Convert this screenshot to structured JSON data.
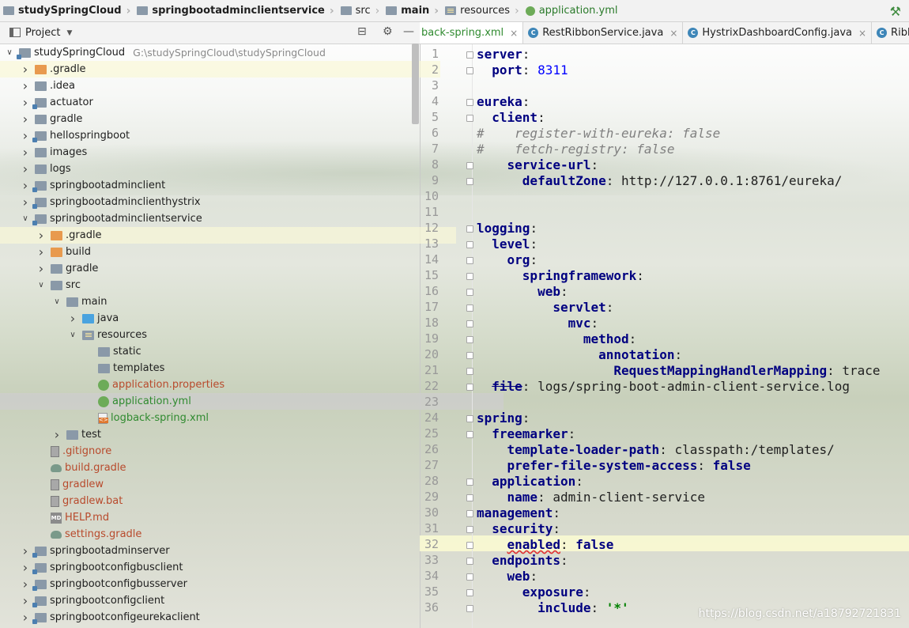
{
  "breadcrumbs": [
    {
      "label": "studySpringCloud",
      "icon": "folder-icon",
      "bold": true
    },
    {
      "label": "springbootadminclientservice",
      "icon": "module-folder-icon",
      "bold": true
    },
    {
      "label": "src",
      "icon": "folder-icon"
    },
    {
      "label": "main",
      "icon": "folder-icon",
      "bold": true
    },
    {
      "label": "resources",
      "icon": "resources-folder-icon"
    },
    {
      "label": "application.yml",
      "icon": "spring-leaf-icon",
      "file": true
    }
  ],
  "project_pane": {
    "title": "Project"
  },
  "tree": [
    {
      "label": "studySpringCloud",
      "path": "G:\\studySpringCloud\\studySpringCloud",
      "depth": 0,
      "arrow": "down",
      "icon": "fo mod"
    },
    {
      "label": ".gradle",
      "depth": 1,
      "arrow": "right",
      "icon": "fo org",
      "hl": true
    },
    {
      "label": ".idea",
      "depth": 1,
      "arrow": "right",
      "icon": "fo"
    },
    {
      "label": "actuator",
      "depth": 1,
      "arrow": "right",
      "icon": "fo mod"
    },
    {
      "label": "gradle",
      "depth": 1,
      "arrow": "right",
      "icon": "fo"
    },
    {
      "label": "hellospringboot",
      "depth": 1,
      "arrow": "right",
      "icon": "fo mod"
    },
    {
      "label": "images",
      "depth": 1,
      "arrow": "right",
      "icon": "fo"
    },
    {
      "label": "logs",
      "depth": 1,
      "arrow": "right",
      "icon": "fo"
    },
    {
      "label": "springbootadminclient",
      "depth": 1,
      "arrow": "right",
      "icon": "fo mod"
    },
    {
      "label": "springbootadminclienthystrix",
      "depth": 1,
      "arrow": "right",
      "icon": "fo mod"
    },
    {
      "label": "springbootadminclientservice",
      "depth": 1,
      "arrow": "down",
      "icon": "fo mod"
    },
    {
      "label": ".gradle",
      "depth": 2,
      "arrow": "right",
      "icon": "fo org",
      "hl": true
    },
    {
      "label": "build",
      "depth": 2,
      "arrow": "right",
      "icon": "fo org"
    },
    {
      "label": "gradle",
      "depth": 2,
      "arrow": "right",
      "icon": "fo"
    },
    {
      "label": "src",
      "depth": 2,
      "arrow": "down",
      "icon": "fo"
    },
    {
      "label": "main",
      "depth": 3,
      "arrow": "down",
      "icon": "fo"
    },
    {
      "label": "java",
      "depth": 4,
      "arrow": "right",
      "icon": "fo blue"
    },
    {
      "label": "resources",
      "depth": 4,
      "arrow": "down",
      "icon": "fo res"
    },
    {
      "label": "static",
      "depth": 5,
      "arrow": "",
      "icon": "fo"
    },
    {
      "label": "templates",
      "depth": 5,
      "arrow": "",
      "icon": "fo"
    },
    {
      "label": "application.properties",
      "depth": 5,
      "arrow": "",
      "icon": "leaf",
      "color": "red"
    },
    {
      "label": "application.yml",
      "depth": 5,
      "arrow": "",
      "icon": "leaf",
      "color": "green",
      "sel": true
    },
    {
      "label": "logback-spring.xml",
      "depth": 5,
      "arrow": "",
      "icon": "xml",
      "color": "green"
    },
    {
      "label": "test",
      "depth": 3,
      "arrow": "right",
      "icon": "fo"
    },
    {
      "label": ".gitignore",
      "depth": 2,
      "arrow": "",
      "icon": "file",
      "color": "red"
    },
    {
      "label": "build.gradle",
      "depth": 2,
      "arrow": "",
      "icon": "gradle",
      "color": "red"
    },
    {
      "label": "gradlew",
      "depth": 2,
      "arrow": "",
      "icon": "file",
      "color": "red"
    },
    {
      "label": "gradlew.bat",
      "depth": 2,
      "arrow": "",
      "icon": "file",
      "color": "red"
    },
    {
      "label": "HELP.md",
      "depth": 2,
      "arrow": "",
      "icon": "md",
      "color": "red"
    },
    {
      "label": "settings.gradle",
      "depth": 2,
      "arrow": "",
      "icon": "gradle",
      "color": "red"
    },
    {
      "label": "springbootadminserver",
      "depth": 1,
      "arrow": "right",
      "icon": "fo mod"
    },
    {
      "label": "springbootconfigbusclient",
      "depth": 1,
      "arrow": "right",
      "icon": "fo mod"
    },
    {
      "label": "springbootconfigbusserver",
      "depth": 1,
      "arrow": "right",
      "icon": "fo mod"
    },
    {
      "label": "springbootconfigclient",
      "depth": 1,
      "arrow": "right",
      "icon": "fo mod"
    },
    {
      "label": "springbootconfigeurekaclient",
      "depth": 1,
      "arrow": "right",
      "icon": "fo mod"
    }
  ],
  "tabs": [
    {
      "label": "back-spring.xml",
      "active": true,
      "icon": "xml-icon"
    },
    {
      "label": "RestRibbonService.java",
      "icon": "class-icon"
    },
    {
      "label": "HystrixDashboardConfig.java",
      "icon": "class-icon"
    },
    {
      "label": "RibbonConfig",
      "icon": "class-icon"
    }
  ],
  "code": [
    [
      [
        "k",
        "server"
      ],
      [
        "p",
        ":"
      ]
    ],
    [
      [
        "p",
        "  "
      ],
      [
        "k",
        "port"
      ],
      [
        "p",
        ": "
      ],
      [
        "n",
        "8311"
      ]
    ],
    [],
    [
      [
        "k",
        "eureka"
      ],
      [
        "p",
        ":"
      ]
    ],
    [
      [
        "p",
        "  "
      ],
      [
        "k",
        "client"
      ],
      [
        "p",
        ":"
      ]
    ],
    [
      [
        "c",
        "#    register-with-eureka: false"
      ]
    ],
    [
      [
        "c",
        "#    fetch-registry: false"
      ]
    ],
    [
      [
        "p",
        "    "
      ],
      [
        "k",
        "service-url"
      ],
      [
        "p",
        ":"
      ]
    ],
    [
      [
        "p",
        "      "
      ],
      [
        "k",
        "defaultZone"
      ],
      [
        "p",
        ": http://127.0.0.1:8761/eureka/"
      ]
    ],
    [],
    [],
    [
      [
        "k",
        "logging"
      ],
      [
        "p",
        ":"
      ]
    ],
    [
      [
        "p",
        "  "
      ],
      [
        "k",
        "level"
      ],
      [
        "p",
        ":"
      ]
    ],
    [
      [
        "p",
        "    "
      ],
      [
        "k",
        "org"
      ],
      [
        "p",
        ":"
      ]
    ],
    [
      [
        "p",
        "      "
      ],
      [
        "k",
        "springframework"
      ],
      [
        "p",
        ":"
      ]
    ],
    [
      [
        "p",
        "        "
      ],
      [
        "k",
        "web"
      ],
      [
        "p",
        ":"
      ]
    ],
    [
      [
        "p",
        "          "
      ],
      [
        "k",
        "servlet"
      ],
      [
        "p",
        ":"
      ]
    ],
    [
      [
        "p",
        "            "
      ],
      [
        "k",
        "mvc"
      ],
      [
        "p",
        ":"
      ]
    ],
    [
      [
        "p",
        "              "
      ],
      [
        "k",
        "method"
      ],
      [
        "p",
        ":"
      ]
    ],
    [
      [
        "p",
        "                "
      ],
      [
        "k",
        "annotation"
      ],
      [
        "p",
        ":"
      ]
    ],
    [
      [
        "p",
        "                  "
      ],
      [
        "k",
        "RequestMappingHandlerMapping"
      ],
      [
        "p",
        ": trace"
      ]
    ],
    [
      [
        "p",
        "  "
      ],
      [
        "ks",
        "file"
      ],
      [
        "p",
        ": logs/spring-boot-admin-client-service.log"
      ]
    ],
    [],
    [
      [
        "k",
        "spring"
      ],
      [
        "p",
        ":"
      ]
    ],
    [
      [
        "p",
        "  "
      ],
      [
        "k",
        "freemarker"
      ],
      [
        "p",
        ":"
      ]
    ],
    [
      [
        "p",
        "    "
      ],
      [
        "k",
        "template-loader-path"
      ],
      [
        "p",
        ": classpath:/templates/"
      ]
    ],
    [
      [
        "p",
        "    "
      ],
      [
        "k",
        "prefer-file-system-access"
      ],
      [
        "p",
        ": "
      ],
      [
        "kw",
        "false"
      ]
    ],
    [
      [
        "p",
        "  "
      ],
      [
        "k",
        "application"
      ],
      [
        "p",
        ":"
      ]
    ],
    [
      [
        "p",
        "    "
      ],
      [
        "k",
        "name"
      ],
      [
        "p",
        ": admin-client-service"
      ]
    ],
    [
      [
        "k",
        "management"
      ],
      [
        "p",
        ":"
      ]
    ],
    [
      [
        "p",
        "  "
      ],
      [
        "k",
        "security"
      ],
      [
        "p",
        ":"
      ]
    ],
    [
      [
        "p",
        "    "
      ],
      [
        "ke",
        "enabled"
      ],
      [
        "p",
        ": "
      ],
      [
        "kw",
        "false"
      ]
    ],
    [
      [
        "p",
        "  "
      ],
      [
        "k",
        "endpoints"
      ],
      [
        "p",
        ":"
      ]
    ],
    [
      [
        "p",
        "    "
      ],
      [
        "k",
        "web"
      ],
      [
        "p",
        ":"
      ]
    ],
    [
      [
        "p",
        "      "
      ],
      [
        "k",
        "exposure"
      ],
      [
        "p",
        ":"
      ]
    ],
    [
      [
        "p",
        "        "
      ],
      [
        "k",
        "include"
      ],
      [
        "p",
        ": "
      ],
      [
        "s",
        "'*'"
      ]
    ]
  ],
  "watermark": "https://blog.csdn.net/a18792721831"
}
